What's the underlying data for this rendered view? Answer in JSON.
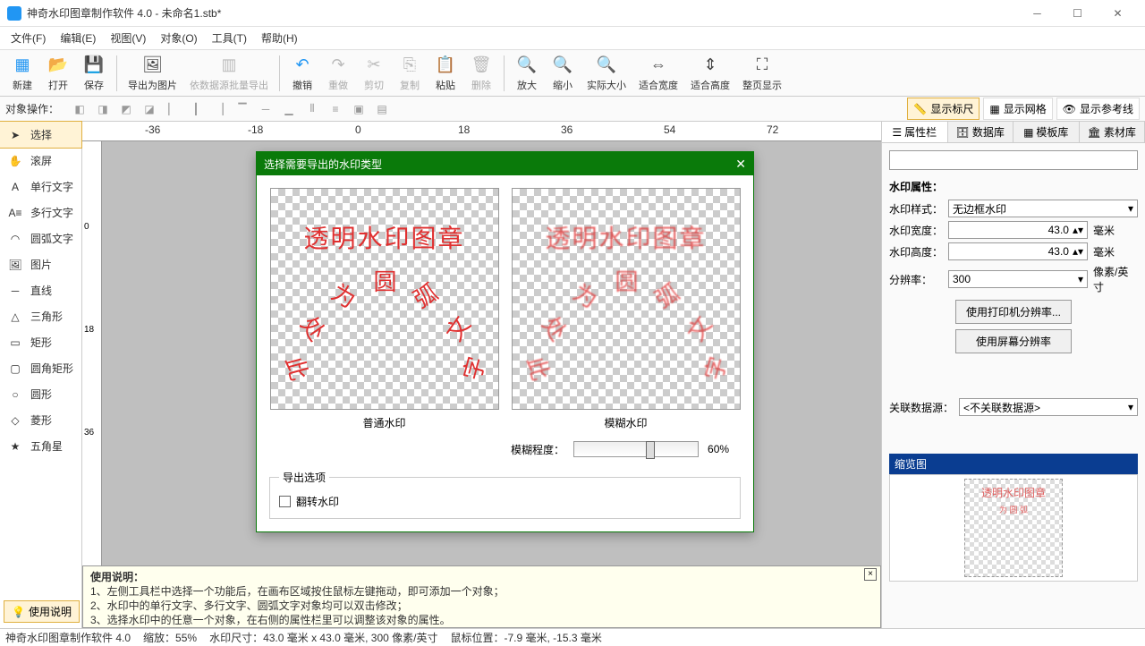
{
  "app": {
    "title": "神奇水印图章制作软件 4.0 - 未命名1.stb*"
  },
  "menu": {
    "file": "文件(F)",
    "edit": "编辑(E)",
    "view": "视图(V)",
    "object": "对象(O)",
    "tools": "工具(T)",
    "help": "帮助(H)"
  },
  "toolbar": {
    "new": "新建",
    "open": "打开",
    "save": "保存",
    "exportImg": "导出为图片",
    "batchExport": "依数据源批量导出",
    "undo": "撤销",
    "redo": "重做",
    "cut": "剪切",
    "copy": "复制",
    "paste": "粘贴",
    "delete": "删除",
    "zoomIn": "放大",
    "zoomOut": "缩小",
    "actualSize": "实际大小",
    "fitWidth": "适合宽度",
    "fitHeight": "适合高度",
    "fitPage": "整页显示"
  },
  "opsbar": {
    "label": "对象操作：",
    "showRuler": "显示标尺",
    "showGrid": "显示网格",
    "showGuides": "显示参考线"
  },
  "leftTools": {
    "select": "选择",
    "pan": "滚屏",
    "singleText": "单行文字",
    "multiText": "多行文字",
    "arcText": "圆弧文字",
    "image": "图片",
    "line": "直线",
    "triangle": "三角形",
    "rect": "矩形",
    "roundRect": "圆角矩形",
    "circle": "圆形",
    "diamond": "菱形",
    "star": "五角星"
  },
  "ruler": {
    "h": [
      "-36",
      "-18",
      "0",
      "18",
      "36",
      "54",
      "72"
    ],
    "v": [
      "0",
      "18",
      "36"
    ]
  },
  "dialog": {
    "title": "选择需要导出的水印类型",
    "normal": "普通水印",
    "blurred": "模糊水印",
    "blurLabel": "模糊程度：",
    "blurValue": "60%",
    "exportOptions": "导出选项",
    "flip": "翻转水印",
    "wmLine1": "透明水印图章",
    "arcChars": [
      "此",
      "处",
      "为",
      "圆",
      "弧",
      "文",
      "字"
    ]
  },
  "rightTabs": {
    "props": "属性栏",
    "data": "数据库",
    "templates": "模板库",
    "materials": "素材库"
  },
  "props": {
    "header": "水印属性：",
    "styleLabel": "水印样式：",
    "styleValue": "无边框水印",
    "widthLabel": "水印宽度：",
    "widthValue": "43.0",
    "widthUnit": "毫米",
    "heightLabel": "水印高度：",
    "heightValue": "43.0",
    "heightUnit": "毫米",
    "dpiLabel": "分辨率：",
    "dpiValue": "300",
    "dpiUnit": "像素/英寸",
    "usePrinter": "使用打印机分辨率...",
    "useScreen": "使用屏幕分辨率",
    "linkLabel": "关联数据源：",
    "linkValue": "<不关联数据源>",
    "thumbHeader": "缩览图"
  },
  "help": {
    "btn": "使用说明",
    "header": "使用说明：",
    "l1": "1、左侧工具栏中选择一个功能后，在画布区域按住鼠标左键拖动，即可添加一个对象；",
    "l2": "2、水印中的单行文字、多行文字、圆弧文字对象均可以双击修改；",
    "l3": "3、选择水印中的任意一个对象，在右侧的属性栏里可以调整该对象的属性。"
  },
  "status": {
    "app": "神奇水印图章制作软件 4.0",
    "zoom": "缩放：55%",
    "size": "水印尺寸：43.0 毫米 x 43.0 毫米, 300 像素/英寸",
    "mouse": "鼠标位置：-7.9 毫米, -15.3 毫米"
  }
}
